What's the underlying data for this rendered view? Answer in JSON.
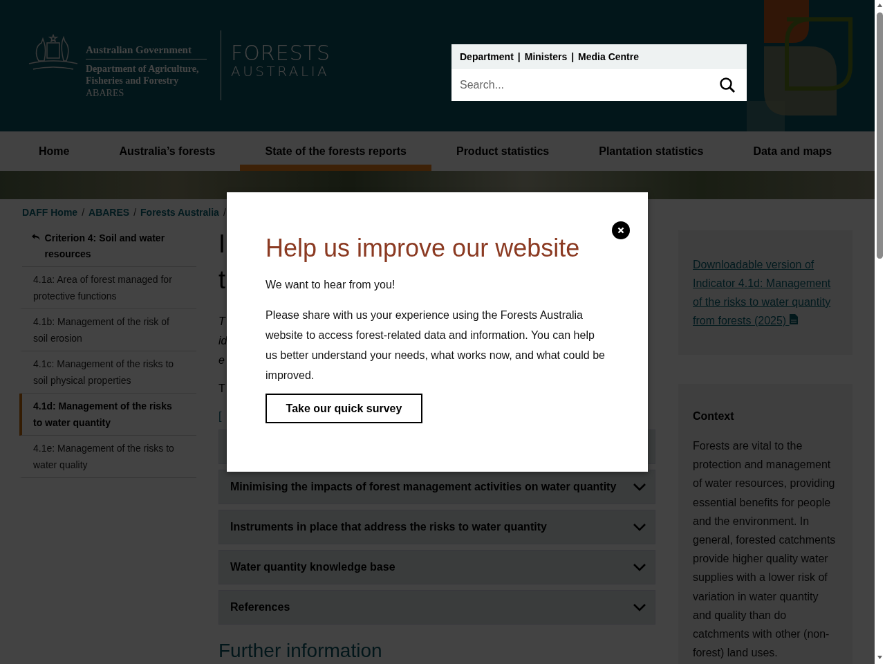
{
  "header": {
    "gov_name": "Australian Government",
    "department": "Department of Agriculture, Fisheries and Forestry",
    "agency": "ABARES",
    "site_title": "FORESTS",
    "site_subtitle": "AUSTRALIA",
    "utility_links": [
      "Department",
      "Ministers",
      "Media Centre"
    ],
    "utility_separators": [
      "|",
      "|"
    ],
    "search": {
      "placeholder": "Search..."
    }
  },
  "nav": [
    {
      "label": "Home",
      "selected": false
    },
    {
      "label": "Australia’s forests",
      "selected": false
    },
    {
      "label": "State of the forests reports",
      "selected": true
    },
    {
      "label": "Product statistics",
      "selected": false
    },
    {
      "label": "Plantation statistics",
      "selected": false
    },
    {
      "label": "Data and maps",
      "selected": false
    }
  ],
  "breadcrumb": {
    "items": [
      "DAFF Home",
      "ABARES",
      "Forests Australia"
    ],
    "separators": [
      "/",
      "/",
      "/"
    ]
  },
  "sidebar": {
    "back_link": "Criterion 4: Soil and water resources",
    "items": [
      {
        "label": "4.1a: Area of forest managed for protective functions",
        "selected": false
      },
      {
        "label": "4.1b: Management of the risk of soil erosion",
        "selected": false
      },
      {
        "label": "4.1c: Management of the risks to soil physical properties",
        "selected": false
      },
      {
        "label": "4.1d: Management of the risks to water quantity",
        "selected": true
      },
      {
        "label": "4.1e: Management of the risks to water quality",
        "selected": false
      }
    ]
  },
  "main": {
    "title_fragments": [
      "I",
      "t"
    ],
    "intro_fragments": [
      "T",
      "id",
      "e"
    ],
    "para_fragment": "T",
    "link_fragment": "[",
    "accordion": [
      {
        "title": "Minimising the impacts of forest management activities on water quantity",
        "expanded": false
      },
      {
        "title": "Instruments in place that address the risks to water quantity",
        "expanded": false
      },
      {
        "title": "Water quantity knowledge base",
        "expanded": false
      },
      {
        "title": "References",
        "expanded": false
      }
    ],
    "further_heading": "Further information"
  },
  "aside": {
    "download_link": "Downloadable version of Indicator 4.1d: Management of the risks to water quantity from forests (2025)",
    "context_title": "Context",
    "context_text": "Forests are vital to the protection and management of water resources, providing essential benefits for people and the environment. In general, forested catchments provide higher quality water supplies with a lower risk of variation in water quantity and quality than do catchments with other (non-forest) land uses."
  },
  "modal": {
    "title": "Help us improve our website",
    "lead": "We want to hear from you!",
    "body": "Please share with us your experience using the Forests Australia website to access forest-related data and information. You can help us better understand your needs, what works now, and what could be improved.",
    "button": "Take our quick survey"
  }
}
